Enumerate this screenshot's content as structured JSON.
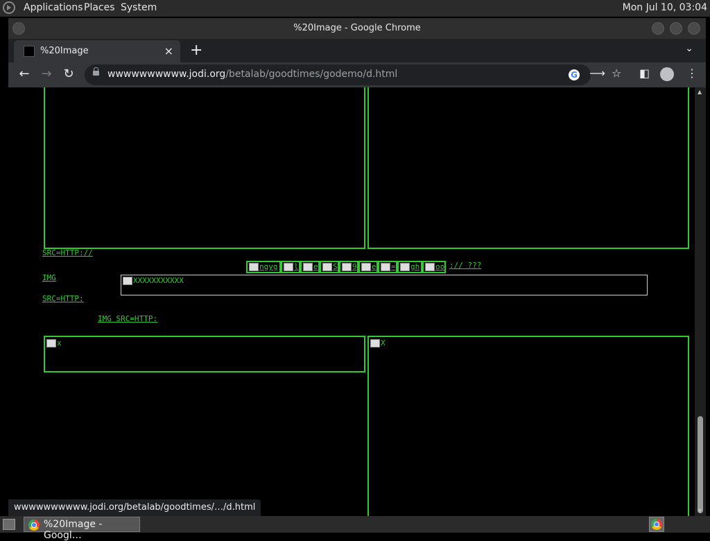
{
  "os": {
    "menu": [
      "Applications",
      "Places",
      "System"
    ],
    "clock": "Mon Jul 10, 03:04"
  },
  "window": {
    "title": "%20Image - Google Chrome"
  },
  "tab": {
    "title": "%20Image",
    "close_icon": "×"
  },
  "toolbar": {
    "url_host": "wwwwwwwwww.jodi.org",
    "url_path": "/betalab/goodtimes/godemo/d.html"
  },
  "page": {
    "link_src_http": "SRC=HTTP://",
    "link_img": "IMG",
    "link_src_http_short": "SRC=HTTP:",
    "link_img_src_http": "IMG SRC=HTTP:",
    "strip_cells": [
      "ngyg",
      "l",
      "e",
      "S",
      "9",
      "e",
      "=",
      "gh",
      "oo"
    ],
    "strip_trailing": ":// ???",
    "whitebox_label": "XXXXXXXXXXX",
    "box_label_left": "x",
    "box_label_right": "X"
  },
  "status_bar": {
    "text": "wwwwwwwwww.jodi.org/betalab/goodtimes/…/d.html"
  },
  "taskbar": {
    "item_label": "%20Image - Googl…"
  },
  "colors": {
    "accent_green": "#2ecc2e",
    "page_bg": "#000000"
  }
}
